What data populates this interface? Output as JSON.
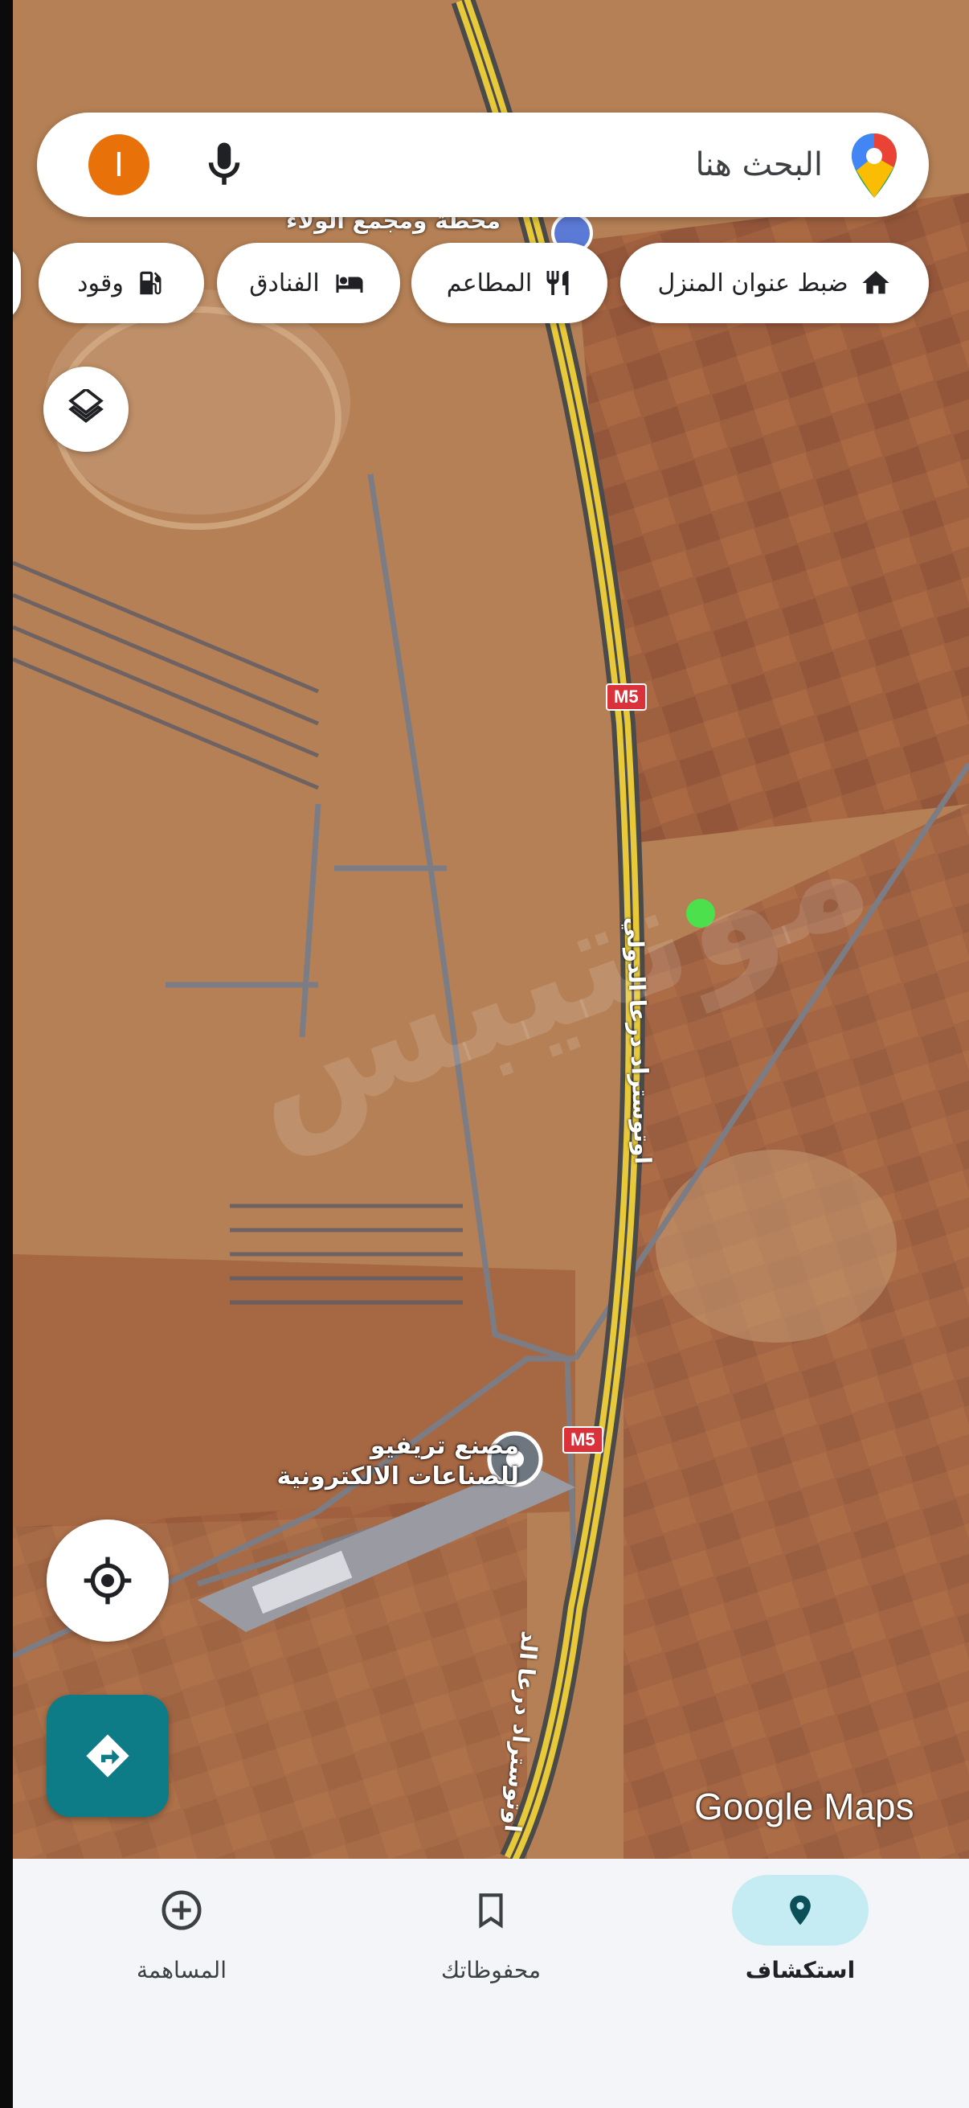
{
  "search": {
    "avatar_letter": "I",
    "placeholder": "البحث هنا",
    "mic_icon": "mic-icon",
    "logo_icon": "google-maps-pin-icon"
  },
  "chips": [
    {
      "label": "ضبط عنوان المنزل",
      "icon": "home-icon"
    },
    {
      "label": "المطاعم",
      "icon": "restaurant-icon"
    },
    {
      "label": "الفنادق",
      "icon": "hotel-icon"
    },
    {
      "label": "وقود",
      "icon": "fuel-icon"
    }
  ],
  "map": {
    "place_label": "مصنع تريفيو للصناعات الالكترونية",
    "top_label": "محطة ومجمع الولاء",
    "road_label_1": "اوتوستراد درعا الدولي",
    "road_label_2": "اوتوستراد درعا الد",
    "shield_1": "M5",
    "shield_2": "M5",
    "watermark": "مونتيبس",
    "attribution": "Google Maps"
  },
  "nav": {
    "items": [
      {
        "label": "المساهمة",
        "icon": "contribute-icon",
        "active": false
      },
      {
        "label": "محفوظاتك",
        "icon": "bookmark-icon",
        "active": false
      },
      {
        "label": "استكشاف",
        "icon": "explore-pin-icon",
        "active": true
      }
    ]
  },
  "colors": {
    "accent": "#0d7c86",
    "avatar": "#e8710a",
    "active_nav": "#c6ecf3",
    "road": "#e8c93a"
  }
}
